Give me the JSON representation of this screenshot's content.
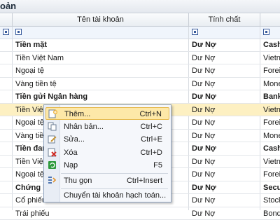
{
  "title": "oản",
  "columns": {
    "account_name": "Tên tài khoản",
    "nature": "Tính chất"
  },
  "rows": [
    {
      "name": "Tiền mặt",
      "nature": "Dư Nợ",
      "extra": "Cash",
      "bold": true
    },
    {
      "name": "Tiền Việt Nam",
      "nature": "Dư Nợ",
      "extra": "Vietna",
      "bold": false
    },
    {
      "name": "Ngoại tệ",
      "nature": "Dư Nợ",
      "extra": "Foreig",
      "bold": false
    },
    {
      "name": "Vàng tiền tệ",
      "nature": "Dư Nợ",
      "extra": "Monet",
      "bold": false
    },
    {
      "name": "Tiền gửi Ngân hàng",
      "nature": "Dư Nợ",
      "extra": "Bank",
      "bold": true
    },
    {
      "name": "Tiền Việt N",
      "nature": "Dư Nợ",
      "extra": "Vietna",
      "bold": false,
      "selected": true
    },
    {
      "name": "Ngoại tệ",
      "nature": "Dư Nợ",
      "extra": "Foreig",
      "bold": false
    },
    {
      "name": "Vàng tiền tệ",
      "nature": "Dư Nợ",
      "extra": "Monet",
      "bold": false
    },
    {
      "name": "Tiền đan",
      "nature": "Dư Nợ",
      "extra": "Cash",
      "bold": true
    },
    {
      "name": "Tiền Việt N",
      "nature": "Dư Nợ",
      "extra": "Vietna",
      "bold": false
    },
    {
      "name": "Ngoại tệ",
      "nature": "Dư Nợ",
      "extra": "Foreig",
      "bold": false
    },
    {
      "name": "Chứng k",
      "nature": "Dư Nợ",
      "extra": "Secu",
      "bold": true
    },
    {
      "name": "Cổ phiếu",
      "nature": "Dư Nợ",
      "extra": "Stock",
      "bold": false
    },
    {
      "name": "Trái phiếu",
      "nature": "Dư Nợ",
      "extra": "Bonds",
      "bold": false
    }
  ],
  "context_menu": {
    "items": [
      {
        "label": "Thêm...",
        "shortcut": "Ctrl+N",
        "icon": "add-icon",
        "highlighted": true
      },
      {
        "label": "Nhân bản...",
        "shortcut": "Ctrl+C",
        "icon": "duplicate-icon"
      },
      {
        "label": "Sửa...",
        "shortcut": "Ctrl+E",
        "icon": "edit-icon"
      },
      {
        "label": "Xóa",
        "shortcut": "Ctrl+D",
        "icon": "delete-icon"
      },
      {
        "label": "Nạp",
        "shortcut": "F5",
        "icon": "refresh-icon"
      },
      {
        "label": "Thu gọn",
        "shortcut": "Ctrl+Insert",
        "icon": "collapse-icon"
      },
      {
        "label": "Chuyển tài khoản hạch toán...",
        "shortcut": "",
        "icon": "none"
      }
    ]
  },
  "colors": {
    "selected_row": "#fdf0c2",
    "menu_highlight": "#fde8a8",
    "header_bg": "#e9edf2"
  }
}
